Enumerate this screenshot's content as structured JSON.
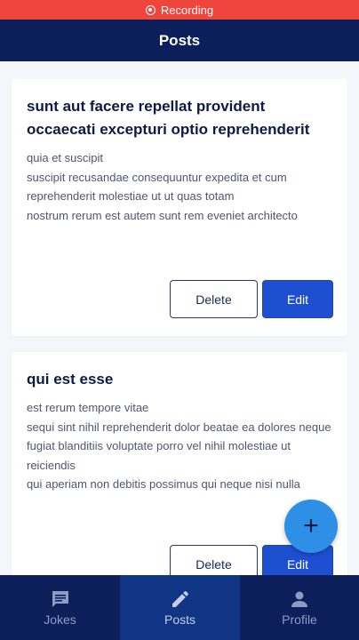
{
  "status_bar": {
    "recording_label": "Recording"
  },
  "header": {
    "title": "Posts"
  },
  "posts": [
    {
      "title": "sunt aut facere repellat provident occaecati excepturi optio reprehenderit",
      "body": "quia et suscipit\nsuscipit recusandae consequuntur expedita et cum reprehenderit molestiae ut ut quas totam\nnostrum rerum est autem sunt rem eveniet architecto",
      "delete_label": "Delete",
      "edit_label": "Edit"
    },
    {
      "title": "qui est esse",
      "body": "est rerum tempore vitae\nsequi sint nihil reprehenderit dolor beatae ea dolores neque\nfugiat blanditiis voluptate porro vel nihil molestiae ut reiciendis\nqui aperiam non debitis possimus qui neque nisi nulla",
      "delete_label": "Delete",
      "edit_label": "Edit"
    }
  ],
  "fab": {
    "icon": "plus-icon",
    "label": "+"
  },
  "bottom_nav": {
    "items": [
      {
        "label": "Jokes",
        "icon": "chat-icon"
      },
      {
        "label": "Posts",
        "icon": "pencil-icon",
        "active": true
      },
      {
        "label": "Profile",
        "icon": "person-icon"
      }
    ]
  },
  "colors": {
    "header": "#0c1f5a",
    "recording": "#f0453d",
    "primary": "#1f4fd1",
    "fab": "#2e8fe6",
    "nav_active": "#103585"
  }
}
